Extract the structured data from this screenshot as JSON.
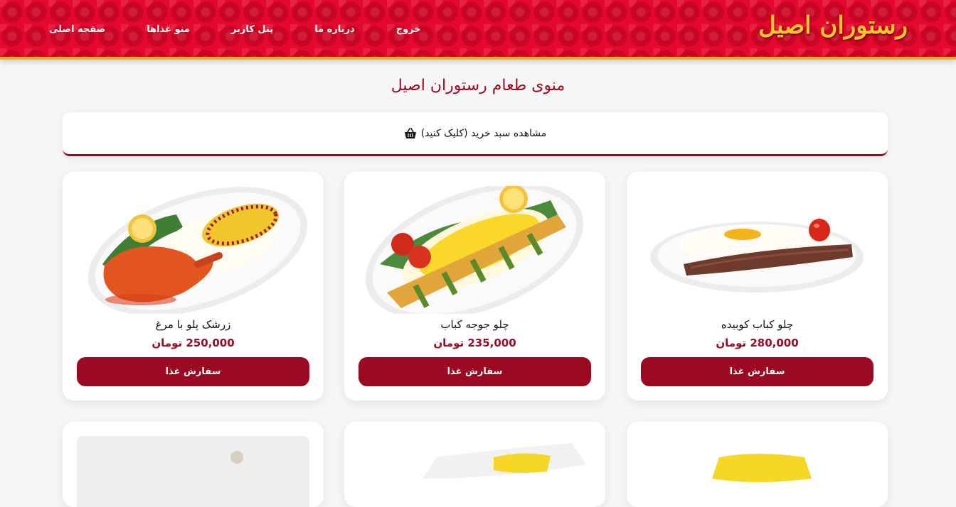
{
  "header": {
    "logo": "رستوران اصیل",
    "nav": [
      "صفحه اصلی",
      "منو غذاها",
      "پنل کاربر",
      "درباره ما",
      "خروج"
    ]
  },
  "page_title": "منوی طعام رستوران اصیل",
  "cart": {
    "label": "مشاهده سبد خرید (کلیک کنید)",
    "icon": "basket-icon"
  },
  "colors": {
    "brand": "#9b0a22",
    "header": "#e4082d",
    "accent": "#f5a623",
    "logo": "#f6c531"
  },
  "foods": [
    {
      "name": "چلو کباب کوبیده",
      "price": "280,000 تومان",
      "button": "سفارش غذا"
    },
    {
      "name": "چلو جوجه کباب",
      "price": "235,000 تومان",
      "button": "سفارش غذا"
    },
    {
      "name": "زرشک پلو با مرغ",
      "price": "250,000 تومان",
      "button": "سفارش غذا"
    }
  ]
}
